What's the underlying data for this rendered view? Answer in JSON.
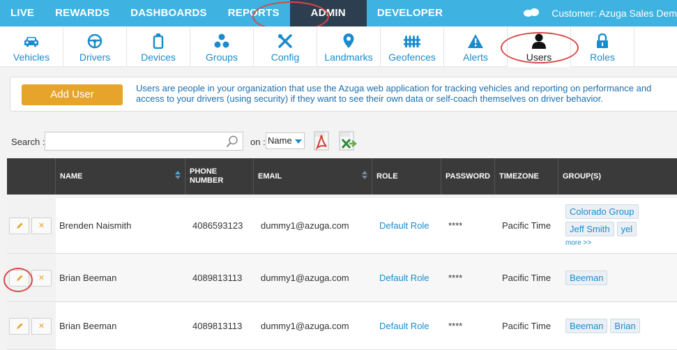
{
  "topnav": {
    "items": [
      "LIVE",
      "REWARDS",
      "DASHBOARDS",
      "REPORTS",
      "ADMIN",
      "DEVELOPER"
    ],
    "active": "ADMIN",
    "customer": "Customer: Azuga Sales Dem"
  },
  "subnav": {
    "tabs": [
      {
        "label": "Vehicles",
        "icon": "car-icon"
      },
      {
        "label": "Drivers",
        "icon": "steering-wheel-icon"
      },
      {
        "label": "Devices",
        "icon": "device-icon"
      },
      {
        "label": "Groups",
        "icon": "groups-icon"
      },
      {
        "label": "Config",
        "icon": "wrench-icon"
      },
      {
        "label": "Landmarks",
        "icon": "map-pin-icon"
      },
      {
        "label": "Geofences",
        "icon": "fence-icon"
      },
      {
        "label": "Alerts",
        "icon": "warning-icon"
      },
      {
        "label": "Users",
        "icon": "user-icon"
      },
      {
        "label": "Roles",
        "icon": "lock-icon"
      }
    ],
    "active": "Users"
  },
  "info": {
    "add_button": "Add User",
    "line1": "Users are people in your organization that use the Azuga web application for tracking vehicles and reporting on performance and",
    "line2": "access to your drivers (using security) if they want to see their own data or self-coach themselves on driver behavior."
  },
  "search": {
    "label": "Search :",
    "placeholder": "",
    "on_label": "on :",
    "on_value": "Name"
  },
  "table": {
    "headers": [
      "NAME",
      "PHONE NUMBER",
      "EMAIL",
      "ROLE",
      "PASSWORD",
      "TIMEZONE",
      "GROUP(S)"
    ],
    "rows": [
      {
        "name": "Brenden Naismith",
        "phone": "4086593123",
        "email": "dummy1@azuga.com",
        "role": "Default Role",
        "password": "****",
        "timezone": "Pacific Time",
        "groups": [
          "Colorado Group",
          "Jeff Smith",
          "yel"
        ],
        "more": "more >>"
      },
      {
        "name": "Brian Beeman",
        "phone": "4089813113",
        "email": "dummy1@azuga.com",
        "role": "Default Role",
        "password": "****",
        "timezone": "Pacific Time",
        "groups": [
          "Beeman"
        ],
        "more": ""
      },
      {
        "name": "Brian Beeman",
        "phone": "4089813113",
        "email": "dummy1@azuga.com",
        "role": "Default Role",
        "password": "****",
        "timezone": "Pacific Time",
        "groups": [
          "Beeman",
          "Brian"
        ],
        "more": ""
      }
    ]
  },
  "colors": {
    "brand_blue": "#3eb2e0",
    "admin_active": "#2c3e4f",
    "accent_orange": "#e6a52a",
    "link_blue": "#1a8ccd",
    "annotation_red": "#d94848"
  }
}
